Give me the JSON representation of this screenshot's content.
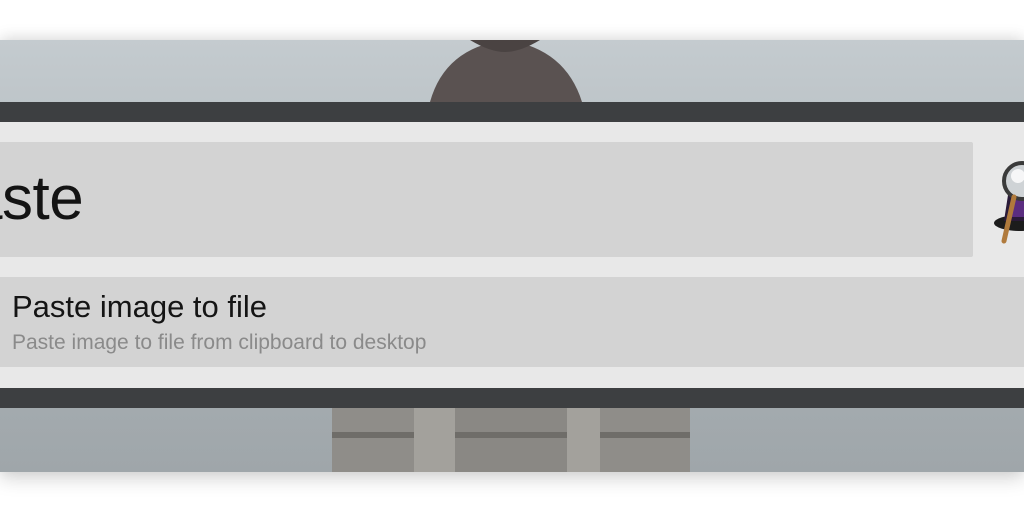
{
  "launcher": {
    "query": "aste",
    "app_icon": "alfred-hat-magnifier-icon"
  },
  "results": [
    {
      "title": "Paste image to file",
      "subtitle": "Paste image to file from clipboard to desktop"
    }
  ],
  "colors": {
    "window_frame": "#3d3f41",
    "panel": "#e8e8e8",
    "field": "#d3d3d3",
    "text": "#141414",
    "subtext": "#8a8a8a"
  }
}
